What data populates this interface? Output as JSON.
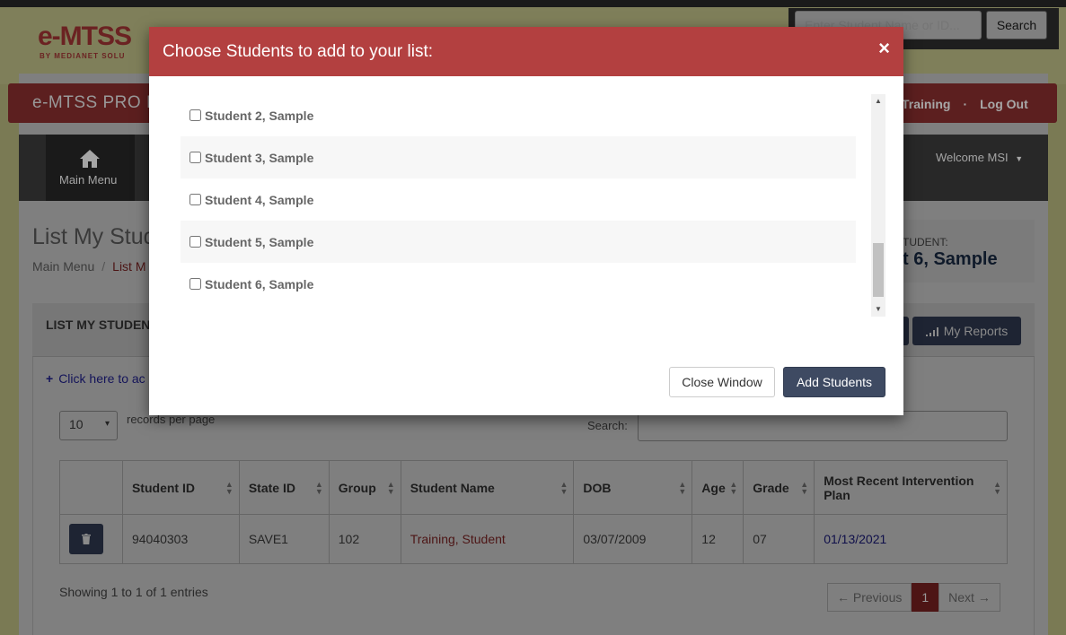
{
  "header": {
    "logo_text": "e-MTSS",
    "logo_sub": "BY MEDIANET SOLU",
    "search_placeholder": "Enter Student Name or ID...",
    "search_button": "Search"
  },
  "brand_bar": {
    "title": "e-MTSS PRO I",
    "training_link": "Training",
    "separator": "·",
    "logout_link": "Log Out"
  },
  "nav": {
    "main_menu": "Main Menu",
    "welcome": "Welcome MSI"
  },
  "page": {
    "title": "List My Stud",
    "breadcrumb_home": "Main Menu",
    "breadcrumb_sep": "/",
    "breadcrumb_current": "List M",
    "student_label": "TUDENT:",
    "student_name": "t 6, Sample"
  },
  "card": {
    "title": "LIST MY STUDEN",
    "reports_button": "My Reports",
    "add_link": "Click here to ac",
    "per_page_value": "10",
    "per_page_label": "records per page",
    "search_label": "Search:"
  },
  "table": {
    "headers": [
      "",
      "Student ID",
      "State ID",
      "Group",
      "Student Name",
      "DOB",
      "Age",
      "Grade",
      "Most Recent Intervention Plan"
    ],
    "rows": [
      {
        "student_id": "94040303",
        "state_id": "SAVE1",
        "group": "102",
        "student_name": "Training, Student",
        "dob": "03/07/2009",
        "age": "12",
        "grade": "07",
        "plan": "01/13/2021"
      }
    ],
    "showing": "Showing 1 to 1 of 1 entries",
    "pager_prev": "← Previous",
    "pager_current": "1",
    "pager_next": "Next →"
  },
  "modal": {
    "title": "Choose Students to add to your list:",
    "close_symbol": "×",
    "students": [
      {
        "label": "Student 2, Sample",
        "checked": false
      },
      {
        "label": "Student 3, Sample",
        "checked": false
      },
      {
        "label": "Student 4, Sample",
        "checked": false
      },
      {
        "label": "Student 5, Sample",
        "checked": false
      },
      {
        "label": "Student 6, Sample",
        "checked": false
      }
    ],
    "close_button": "Close Window",
    "add_button": "Add Students"
  },
  "colors": {
    "modal_header": "#b34040",
    "primary_button": "#3e4a62"
  }
}
